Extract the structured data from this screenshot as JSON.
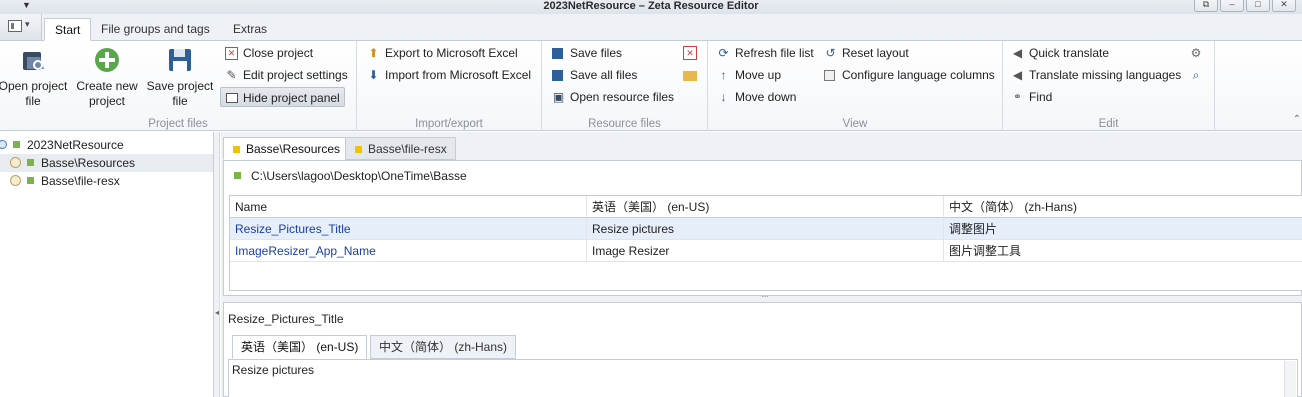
{
  "window": {
    "title": "2023NetResource – Zeta Resource Editor",
    "controls": [
      "restore-icon",
      "minimize-icon",
      "maximize-icon",
      "close-icon"
    ]
  },
  "ribbon_tabs": [
    {
      "label": "Start",
      "active": true
    },
    {
      "label": "File groups and tags",
      "active": false
    },
    {
      "label": "Extras",
      "active": false
    }
  ],
  "ribbon": {
    "project_files": {
      "label": "Project files",
      "open_project_file": "Open project file",
      "create_new_project": "Create new project",
      "save_project_file": "Save project file",
      "close_project": "Close project",
      "edit_project_settings": "Edit project settings",
      "hide_project_panel": "Hide project panel"
    },
    "import_export": {
      "label": "Import/export",
      "export_excel": "Export to Microsoft Excel",
      "import_excel": "Import from Microsoft Excel"
    },
    "resource_files": {
      "label": "Resource files",
      "save_files": "Save files",
      "save_all_files": "Save all files",
      "open_resource_files": "Open resource files"
    },
    "view": {
      "label": "View",
      "refresh_file_list": "Refresh file list",
      "move_up": "Move up",
      "move_down": "Move down",
      "reset_layout": "Reset layout",
      "configure_language_columns": "Configure language columns"
    },
    "edit": {
      "label": "Edit",
      "quick_translate": "Quick translate",
      "translate_missing_languages": "Translate missing languages",
      "find": "Find"
    }
  },
  "tree": {
    "root": "2023NetResource",
    "items": [
      "Basse\\Resources",
      "Basse\\file-resx"
    ]
  },
  "doc_tabs": [
    {
      "label": "Basse\\Resources",
      "active": true
    },
    {
      "label": "Basse\\file-resx",
      "active": false
    }
  ],
  "path": "C:\\Users\\lagoo\\Desktop\\OneTime\\Basse",
  "grid": {
    "columns": [
      "Name",
      "英语（美国） (en-US)",
      "中文（简体） (zh-Hans)"
    ],
    "rows": [
      [
        "Resize_Pictures_Title",
        "Resize pictures",
        "调整图片"
      ],
      [
        "ImageResizer_App_Name",
        "Image Resizer",
        "图片调整工具"
      ]
    ]
  },
  "editor": {
    "key": "Resize_Pictures_Title",
    "lang_tabs": [
      {
        "label": "英语（美国） (en-US)",
        "active": true
      },
      {
        "label": "中文（简体） (zh-Hans)",
        "active": false
      }
    ],
    "value": "Resize pictures"
  }
}
